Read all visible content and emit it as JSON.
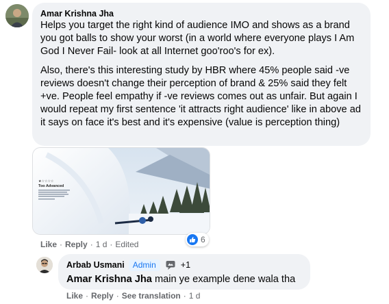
{
  "comment": {
    "author": "Amar Krishna Jha",
    "paragraphs": [
      "Helps you target the right kind of audience IMO and shows as a brand you got balls to show your worst (in a world where everyone plays I Am God I Never Fail- look at all Internet goo'roo's for ex).",
      "Also, there's this interesting study by HBR where 45% people said -ve reviews doesn't change their perception of brand & 25% said they felt +ve. People feel empathy if -ve reviews comes out as unfair. But again I would repeat my first sentence 'it attracts right audience' like in above ad it says on face it's best and it's expensive (value is perception thing)"
    ],
    "attachment": {
      "heading": "Too Advanced",
      "rating_stars": 1
    },
    "reactions": {
      "icon": "like-icon",
      "count": "6"
    },
    "actions": {
      "like": "Like",
      "reply": "Reply",
      "time": "1 d",
      "edited": "Edited"
    }
  },
  "reply": {
    "author": "Arbab Usmani",
    "badge": "Admin",
    "badge_icon": "speech-bubble-icon",
    "plus": "+1",
    "mention": "Amar Krishna Jha",
    "text": " main ye example dene wala tha",
    "actions": {
      "like": "Like",
      "reply": "Reply",
      "translate": "See translation",
      "time": "1 d"
    }
  },
  "colors": {
    "accent": "#1877f2",
    "bubble": "#f0f2f5",
    "muted": "#65676b"
  }
}
